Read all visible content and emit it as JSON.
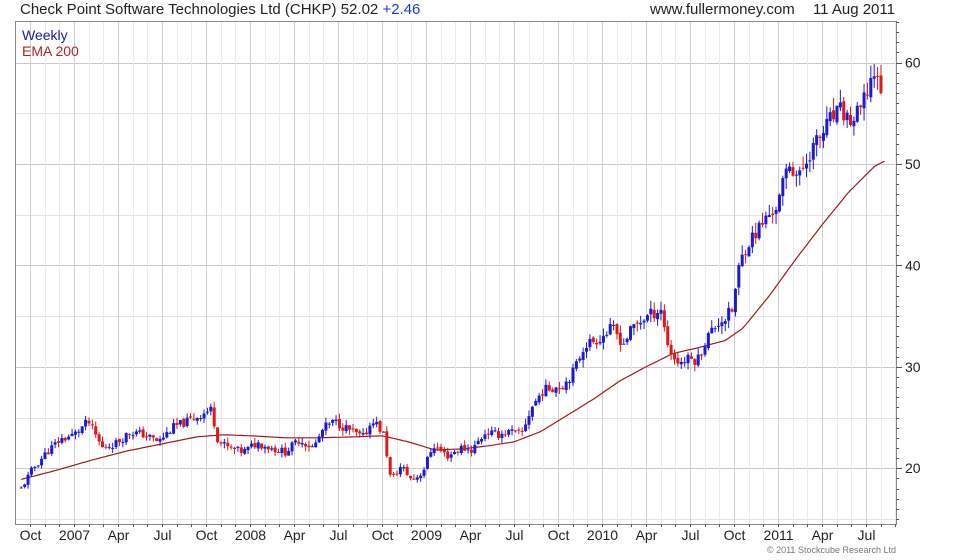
{
  "header": {
    "company": "Check Point Software Technologies Ltd (CHKP)",
    "price": "52.02",
    "change": "+2.46",
    "source": "www.fullermoney.com",
    "date": "11 Aug 2011"
  },
  "footer": {
    "copyright": "© 2011 Stockcube Research Ltd"
  },
  "colors": {
    "up": "#1a1ad6",
    "down": "#e01818",
    "ema": "#a01818",
    "grid": "#d8d8d8"
  },
  "chart_data": {
    "type": "line",
    "subtype": "candlestick",
    "frequency": "weekly",
    "grid": true,
    "y_axis_side": "right",
    "legend": [
      "Weekly",
      "EMA 200"
    ],
    "ylim": [
      14.5,
      64
    ],
    "yticks": [
      20,
      30,
      40,
      50,
      60
    ],
    "x_range": [
      2006.67,
      2011.67
    ],
    "xticks": [
      {
        "label": "Oct",
        "t": 2006.75
      },
      {
        "label": "2007",
        "t": 2007.0
      },
      {
        "label": "Apr",
        "t": 2007.25
      },
      {
        "label": "Jul",
        "t": 2007.5
      },
      {
        "label": "Oct",
        "t": 2007.75
      },
      {
        "label": "2008",
        "t": 2008.0
      },
      {
        "label": "Apr",
        "t": 2008.25
      },
      {
        "label": "Jul",
        "t": 2008.5
      },
      {
        "label": "Oct",
        "t": 2008.75
      },
      {
        "label": "2009",
        "t": 2009.0
      },
      {
        "label": "Apr",
        "t": 2009.25
      },
      {
        "label": "Jul",
        "t": 2009.5
      },
      {
        "label": "Oct",
        "t": 2009.75
      },
      {
        "label": "2010",
        "t": 2010.0
      },
      {
        "label": "Apr",
        "t": 2010.25
      },
      {
        "label": "Jul",
        "t": 2010.5
      },
      {
        "label": "Oct",
        "t": 2010.75
      },
      {
        "label": "2011",
        "t": 2011.0
      },
      {
        "label": "Apr",
        "t": 2011.25
      },
      {
        "label": "Jul",
        "t": 2011.5
      }
    ],
    "price_path": [
      [
        2006.7,
        18.0
      ],
      [
        2006.76,
        19.8
      ],
      [
        2006.84,
        21.5
      ],
      [
        2006.92,
        22.8
      ],
      [
        2007.0,
        23.3
      ],
      [
        2007.08,
        24.6
      ],
      [
        2007.16,
        22.0
      ],
      [
        2007.24,
        22.5
      ],
      [
        2007.32,
        23.6
      ],
      [
        2007.4,
        23.3
      ],
      [
        2007.48,
        22.6
      ],
      [
        2007.56,
        24.0
      ],
      [
        2007.64,
        24.6
      ],
      [
        2007.72,
        25.3
      ],
      [
        2007.78,
        25.8
      ],
      [
        2007.82,
        22.6
      ],
      [
        2007.88,
        22.0
      ],
      [
        2007.96,
        21.6
      ],
      [
        2008.04,
        22.5
      ],
      [
        2008.12,
        22.0
      ],
      [
        2008.2,
        21.6
      ],
      [
        2008.28,
        22.8
      ],
      [
        2008.36,
        22.0
      ],
      [
        2008.42,
        24.0
      ],
      [
        2008.48,
        24.6
      ],
      [
        2008.56,
        23.8
      ],
      [
        2008.64,
        23.0
      ],
      [
        2008.7,
        24.8
      ],
      [
        2008.76,
        23.3
      ],
      [
        2008.8,
        18.8
      ],
      [
        2008.86,
        20.2
      ],
      [
        2008.92,
        18.8
      ],
      [
        2008.98,
        19.6
      ],
      [
        2009.04,
        22.3
      ],
      [
        2009.12,
        21.2
      ],
      [
        2009.2,
        22.0
      ],
      [
        2009.26,
        21.8
      ],
      [
        2009.34,
        23.6
      ],
      [
        2009.4,
        23.3
      ],
      [
        2009.48,
        23.6
      ],
      [
        2009.54,
        23.3
      ],
      [
        2009.6,
        26.0
      ],
      [
        2009.66,
        27.6
      ],
      [
        2009.72,
        28.0
      ],
      [
        2009.78,
        28.2
      ],
      [
        2009.84,
        29.6
      ],
      [
        2009.9,
        32.2
      ],
      [
        2009.96,
        32.6
      ],
      [
        2010.0,
        33.0
      ],
      [
        2010.06,
        33.8
      ],
      [
        2010.12,
        32.3
      ],
      [
        2010.18,
        34.0
      ],
      [
        2010.24,
        34.8
      ],
      [
        2010.3,
        35.4
      ],
      [
        2010.34,
        35.8
      ],
      [
        2010.36,
        33.0
      ],
      [
        2010.4,
        31.0
      ],
      [
        2010.44,
        30.4
      ],
      [
        2010.5,
        30.8
      ],
      [
        2010.54,
        30.6
      ],
      [
        2010.6,
        33.0
      ],
      [
        2010.66,
        34.4
      ],
      [
        2010.7,
        34.8
      ],
      [
        2010.74,
        35.6
      ],
      [
        2010.78,
        40.0
      ],
      [
        2010.82,
        42.0
      ],
      [
        2010.88,
        43.4
      ],
      [
        2010.94,
        44.8
      ],
      [
        2011.0,
        46.0
      ],
      [
        2011.06,
        50.2
      ],
      [
        2011.12,
        48.6
      ],
      [
        2011.18,
        51.2
      ],
      [
        2011.24,
        52.6
      ],
      [
        2011.3,
        54.4
      ],
      [
        2011.36,
        55.2
      ],
      [
        2011.42,
        54.0
      ],
      [
        2011.48,
        55.6
      ],
      [
        2011.52,
        58.0
      ],
      [
        2011.56,
        59.6
      ],
      [
        2011.58,
        57.6
      ],
      [
        2011.6,
        52.02
      ]
    ],
    "ema_200": [
      [
        2006.7,
        18.9
      ],
      [
        2006.9,
        19.8
      ],
      [
        2007.1,
        20.8
      ],
      [
        2007.3,
        21.7
      ],
      [
        2007.5,
        22.4
      ],
      [
        2007.7,
        23.1
      ],
      [
        2007.85,
        23.3
      ],
      [
        2008.0,
        23.2
      ],
      [
        2008.2,
        23.0
      ],
      [
        2008.4,
        23.0
      ],
      [
        2008.6,
        23.1
      ],
      [
        2008.75,
        23.2
      ],
      [
        2008.9,
        22.6
      ],
      [
        2009.05,
        21.8
      ],
      [
        2009.2,
        21.9
      ],
      [
        2009.35,
        22.2
      ],
      [
        2009.5,
        22.6
      ],
      [
        2009.65,
        23.6
      ],
      [
        2009.8,
        25.2
      ],
      [
        2009.95,
        26.8
      ],
      [
        2010.1,
        28.6
      ],
      [
        2010.25,
        30.0
      ],
      [
        2010.4,
        31.3
      ],
      [
        2010.55,
        31.9
      ],
      [
        2010.7,
        32.6
      ],
      [
        2010.8,
        33.8
      ],
      [
        2010.95,
        37.0
      ],
      [
        2011.1,
        40.6
      ],
      [
        2011.25,
        44.0
      ],
      [
        2011.4,
        47.2
      ],
      [
        2011.55,
        49.8
      ],
      [
        2011.62,
        50.4
      ]
    ]
  }
}
